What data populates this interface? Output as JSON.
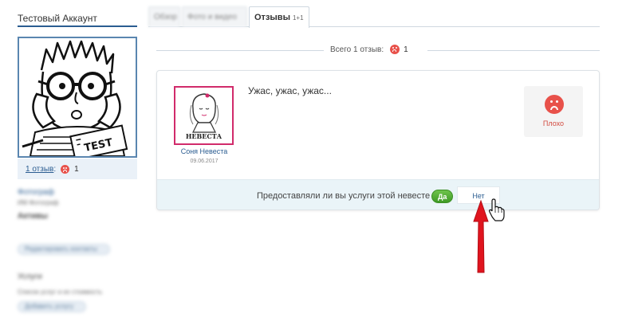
{
  "sidebar": {
    "account_title": "Тестовый Аккаунт",
    "reviews_link": "1 отзыв",
    "reviews_colon": ":",
    "reviews_count": "1",
    "blurred": {
      "photographer": "Фотограф",
      "company": "ИМ Фотограф",
      "assets_heading": "Активы",
      "edit_contacts_btn": "Редактировать контакты",
      "services_heading": "Услуги",
      "services_desc": "Список услуг и их стоимость",
      "add_service_btn": "Добавить услугу"
    }
  },
  "tabs": [
    {
      "label": "Обзор"
    },
    {
      "label": "Фото и видео"
    },
    {
      "label": "Отзывы",
      "badge": "1+1"
    }
  ],
  "total": {
    "label": "Всего 1 отзыв:",
    "count": "1"
  },
  "review": {
    "author": "Соня Невеста",
    "date": "09.06.2017",
    "logo_text": "НЕВЕСТА",
    "text": "Ужас, ужас, ужас...",
    "rating_label": "Плохо",
    "question": "Предоставляли ли вы услуги этой невесте",
    "yes_label": "Да",
    "no_label": "Нет"
  },
  "colors": {
    "accent_blue": "#2b5d91",
    "bad_red": "#e8514a",
    "yes_green": "#4aa82e",
    "photo_border": "#d12b6b",
    "annotation_red": "#e0141e"
  },
  "icons": [
    "sad-face-icon",
    "hand-cursor-icon",
    "red-arrow-annotation"
  ]
}
